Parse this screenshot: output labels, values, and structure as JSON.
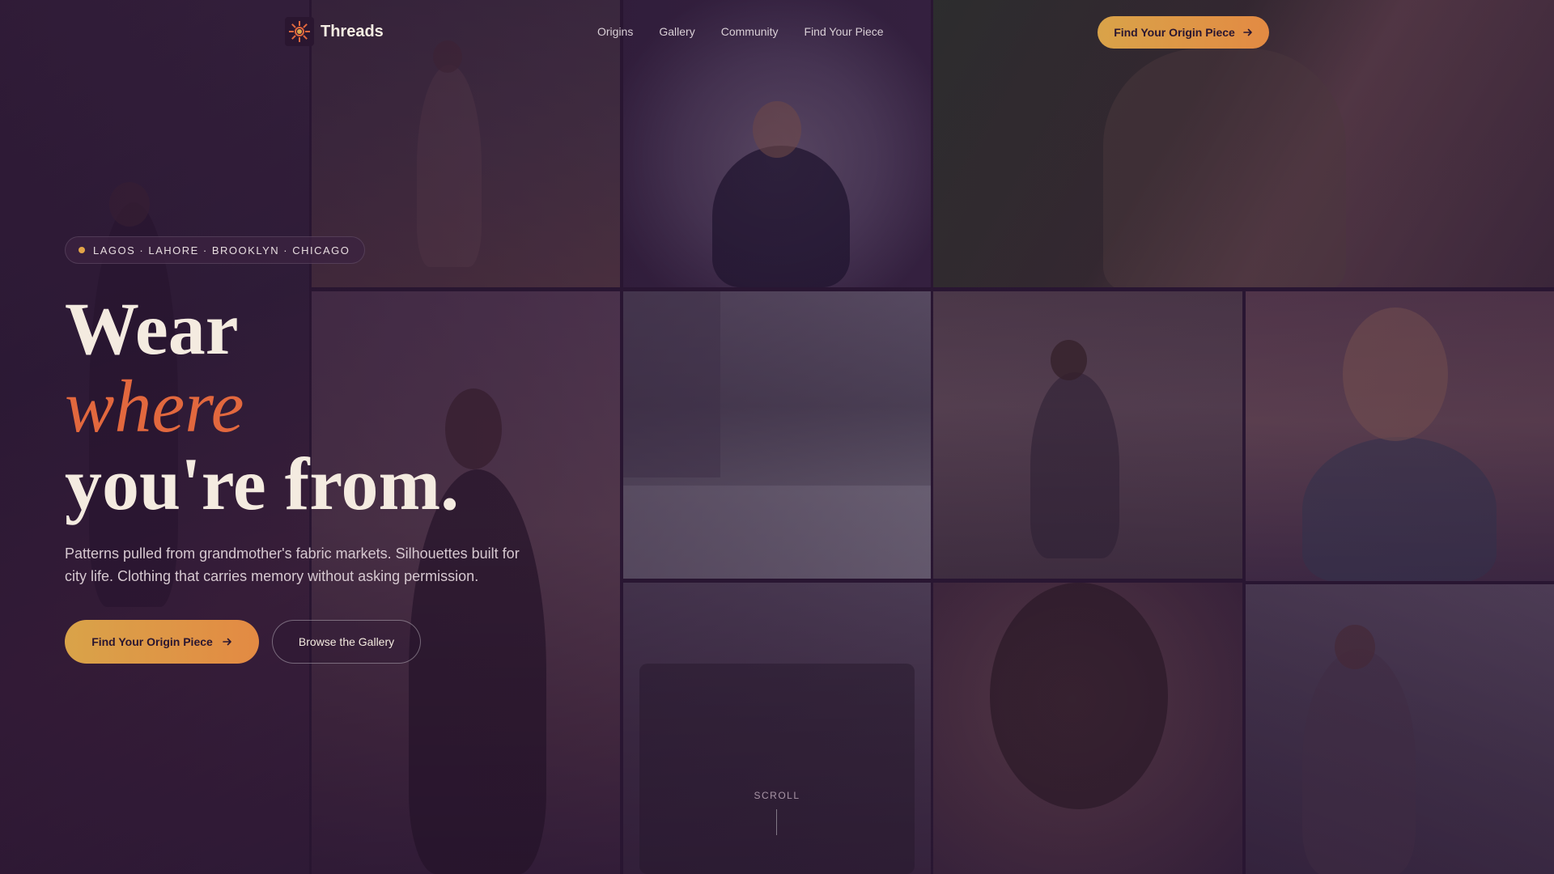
{
  "brand": {
    "name": "Threads",
    "logo_icon": "sunburst-logo-icon"
  },
  "nav": {
    "items": [
      {
        "label": "Origins"
      },
      {
        "label": "Gallery"
      },
      {
        "label": "Community"
      },
      {
        "label": "Find Your Piece"
      }
    ],
    "cta_label": "Find Your Origin Piece"
  },
  "hero": {
    "locations": "LAGOS · LAHORE · BROOKLYN · CHICAGO",
    "headline_line1": "Wear",
    "headline_line2": "where",
    "headline_line3": "you're from.",
    "lede": "Patterns pulled from grandmother's fabric markets. Silhouettes built for city life. Clothing that carries memory without asking permission.",
    "primary_cta": "Find Your Origin Piece",
    "secondary_cta": "Browse the Gallery"
  },
  "scroll_label": "SCROLL",
  "colors": {
    "accent_gold": "#d9a349",
    "accent_orange": "#e2683e",
    "background": "#2a1833",
    "text_cream": "#f4ebe0"
  }
}
